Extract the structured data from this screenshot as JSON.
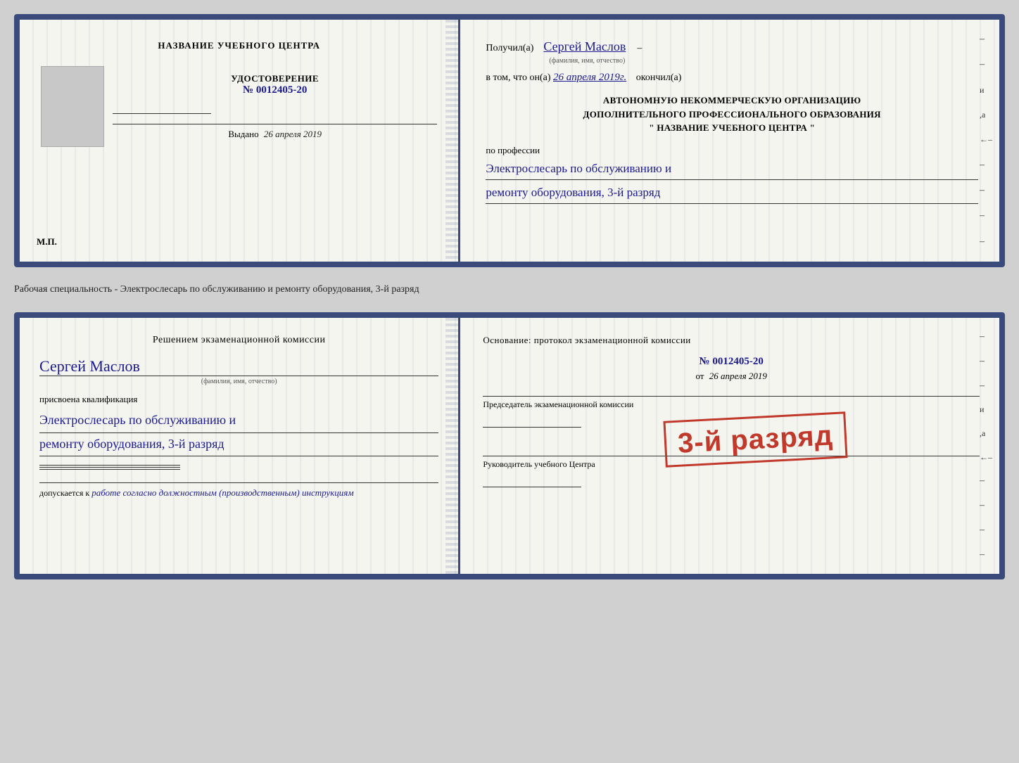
{
  "cert": {
    "left": {
      "training_center_label": "НАЗВАНИЕ УЧЕБНОГО ЦЕНТРА",
      "udostoverenie_label": "УДОСТОВЕРЕНИЕ",
      "number_prefix": "№",
      "number": "0012405-20",
      "vydano_label": "Выдано",
      "vydano_date": "26 апреля 2019",
      "mp_label": "М.П."
    },
    "right": {
      "poluchil_label": "Получил(а)",
      "recipient_name": "Сергей Маслов",
      "fio_label": "(фамилия, имя, отчество)",
      "dash": "–",
      "vtom_label": "в том, что он(а)",
      "date_completed": "26 апреля 2019г.",
      "okonchil_label": "окончил(а)",
      "org_line1": "АВТОНОМНУЮ НЕКОММЕРЧЕСКУЮ ОРГАНИЗАЦИЮ",
      "org_line2": "ДОПОЛНИТЕЛЬНОГО ПРОФЕССИОНАЛЬНОГО ОБРАЗОВАНИЯ",
      "org_quote1": "\"",
      "org_name": "НАЗВАНИЕ УЧЕБНОГО ЦЕНТРА",
      "org_quote2": "\"",
      "po_professii_label": "по профессии",
      "profession_line1": "Электрослесарь по обслуживанию и",
      "profession_line2": "ремонту оборудования, 3-й разряд"
    }
  },
  "separator": {
    "text": "Рабочая специальность - Электрослесарь по обслуживанию и ремонту оборудования, 3-й разряд"
  },
  "bottom": {
    "left": {
      "resheniem_label": "Решением экзаменационной комиссии",
      "name": "Сергей Маслов",
      "fio_label": "(фамилия, имя, отчество)",
      "prisvoena_label": "присвоена квалификация",
      "qualification_line1": "Электрослесарь по обслуживанию и",
      "qualification_line2": "ремонту оборудования, 3-й разряд",
      "dopuskaetsya_label": "допускается к",
      "dopuskaetsya_value": "работе согласно должностным (производственным) инструкциям"
    },
    "right": {
      "osnovanie_label": "Основание: протокол экзаменационной комиссии",
      "number_prefix": "№",
      "number": "0012405-20",
      "ot_label": "от",
      "ot_date": "26 апреля 2019",
      "predsedatel_label": "Председатель экзаменационной комиссии",
      "rukovoditel_label": "Руководитель учебного Центра"
    },
    "stamp": {
      "text": "3-й разряд"
    }
  }
}
